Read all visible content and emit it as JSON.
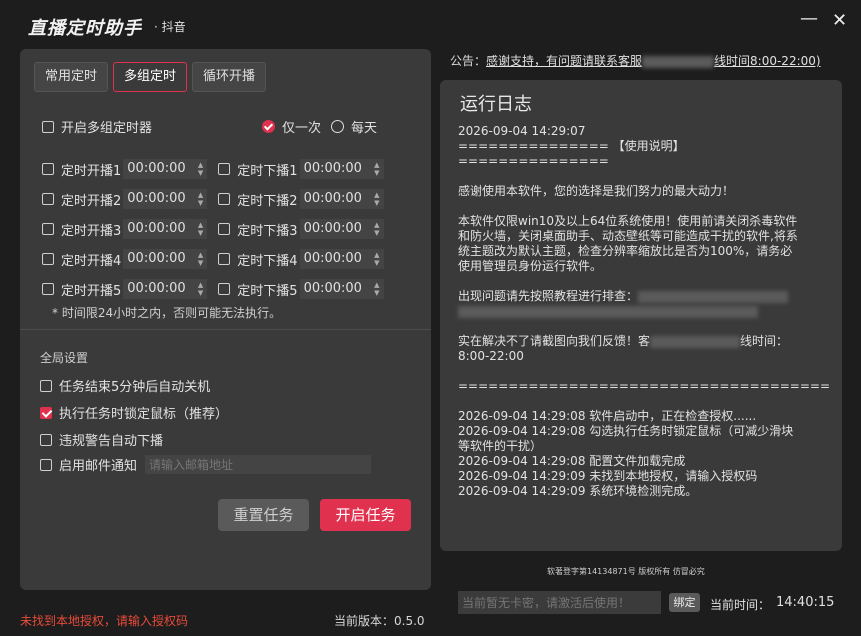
{
  "app": {
    "title": "直播定时助手",
    "subtitle": "· 抖音",
    "min_icon": "—",
    "close_icon": "✕"
  },
  "tabs": [
    {
      "label": "常用定时"
    },
    {
      "label": "多组定时",
      "active": true
    },
    {
      "label": "循环开播"
    }
  ],
  "multi": {
    "enable_label": "开启多组定时器",
    "enable_checked": false,
    "repeat_options": [
      {
        "label": "仅一次",
        "selected": true
      },
      {
        "label": "每天",
        "selected": false
      }
    ],
    "groups": [
      {
        "start_label": "定时开播1",
        "start_time": "00:00:00",
        "stop_label": "定时下播1",
        "stop_time": "00:00:00"
      },
      {
        "start_label": "定时开播2",
        "start_time": "00:00:00",
        "stop_label": "定时下播2",
        "stop_time": "00:00:00"
      },
      {
        "start_label": "定时开播3",
        "start_time": "00:00:00",
        "stop_label": "定时下播3",
        "stop_time": "00:00:00"
      },
      {
        "start_label": "定时开播4",
        "start_time": "00:00:00",
        "stop_label": "定时下播4",
        "stop_time": "00:00:00"
      },
      {
        "start_label": "定时开播5",
        "start_time": "00:00:00",
        "stop_label": "定时下播5",
        "stop_time": "00:00:00"
      }
    ],
    "note": "* 时间限24小时之内，否则可能无法执行。"
  },
  "global": {
    "section_label": "全局设置",
    "options": [
      {
        "label": "任务结束5分钟后自动关机",
        "checked": false
      },
      {
        "label": "执行任务时锁定鼠标（推荐）",
        "checked": true
      },
      {
        "label": "违规警告自动下播",
        "checked": false
      },
      {
        "label": "启用邮件通知",
        "checked": false
      }
    ],
    "email_placeholder": "请输入邮箱地址"
  },
  "buttons": {
    "reset": "重置任务",
    "start": "开启任务"
  },
  "status": {
    "error": "未找到本地授权，请输入授权码",
    "version": "当前版本：0.5.0"
  },
  "notice": {
    "prefix": "公告：",
    "text_a": "感谢支持，有问题请联系客服",
    "text_b": "线时间8:00-22:00)"
  },
  "log": {
    "title": "运行日志",
    "lines": [
      "2026-09-04 14:29:07",
      "=============== 【使用说明】 ===============",
      "",
      "感谢使用本软件，您的选择是我们努力的最大动力！",
      "",
      "本软件仅限win10及以上64位系统使用！使用前请关闭杀毒软件和防火墙，关闭桌面助手、动态壁纸等可能造成干扰的软件,将系统主题改为默认主题，检查分辨率缩放比是否为100%，请务必使用管理员身份运行软件。",
      "",
      "出现问题请先按照教程进行排查：",
      "",
      "",
      "实在解决不了请截图向我们反馈！客",
      "8:00-22:00",
      "",
      "=====================================",
      "",
      "2026-09-04 14:29:08 软件启动中，正在检查授权......",
      "2026-09-04 14:29:08 勾选执行任务时锁定鼠标（可减少滑块等软件的干扰）",
      "2026-09-04 14:29:08 配置文件加载完成",
      "2026-09-04 14:29:09 未找到本地授权，请输入授权码",
      "2026-09-04 14:29:09 系统环境检测完成。"
    ],
    "contact_suffix": "线时间："
  },
  "footer": {
    "copyright": "软著登字第14134871号 版权所有 仿冒必究",
    "card_placeholder": "当前暂无卡密，请激活后使用！",
    "bind_label": "绑定",
    "clock_label": "当前时间：",
    "clock_value": "14:40:15"
  },
  "colors": {
    "accent": "#e0314f",
    "error": "#e84b3a",
    "panel": "#3a3a3a",
    "background": "#1d1d1d"
  }
}
